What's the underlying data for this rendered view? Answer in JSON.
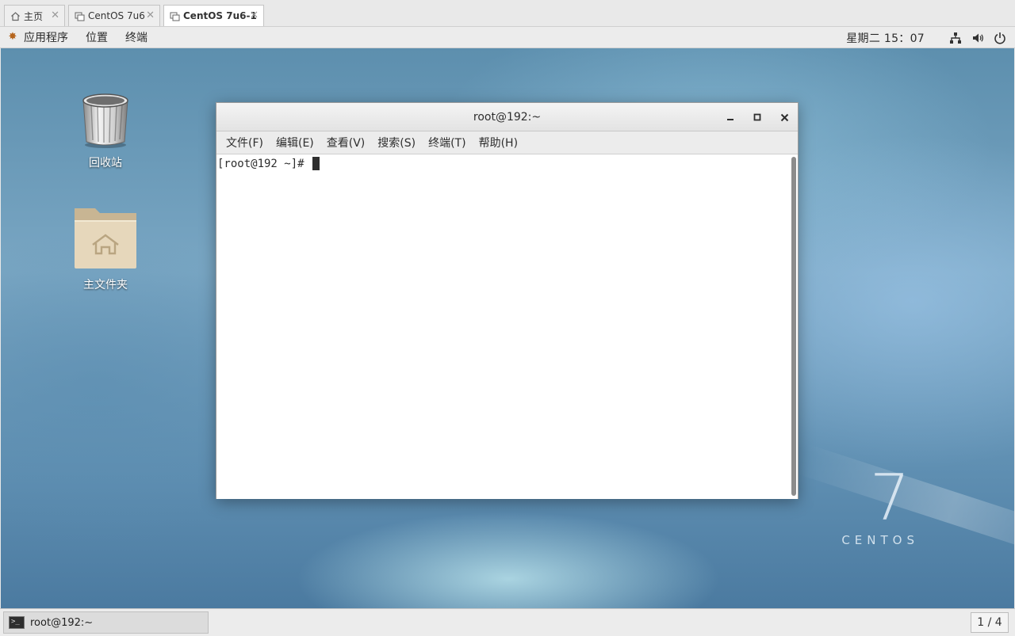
{
  "host_tabs": [
    {
      "label": "主页",
      "icon": "home-icon",
      "active": false
    },
    {
      "label": "CentOS 7u6",
      "icon": "vm-icon",
      "active": false
    },
    {
      "label": "CentOS 7u6-1",
      "icon": "vm-icon",
      "active": true
    }
  ],
  "top_panel": {
    "applications": "应用程序",
    "places": "位置",
    "terminal": "终端",
    "clock": "星期二 15：07",
    "icons": [
      "network-icon",
      "volume-icon",
      "power-icon"
    ]
  },
  "desktop": {
    "icons": [
      {
        "label": "回收站",
        "icon": "trash-icon"
      },
      {
        "label": "主文件夹",
        "icon": "home-folder-icon"
      }
    ],
    "watermark": {
      "number": "7",
      "word": "CENTOS"
    }
  },
  "terminal_window": {
    "title": "root@192:~",
    "menu": [
      "文件(F)",
      "编辑(E)",
      "查看(V)",
      "搜索(S)",
      "终端(T)",
      "帮助(H)"
    ],
    "prompt": "[root@192 ~]# "
  },
  "bottom_panel": {
    "task_label": "root@192:~",
    "workspace": "1 / 4"
  }
}
